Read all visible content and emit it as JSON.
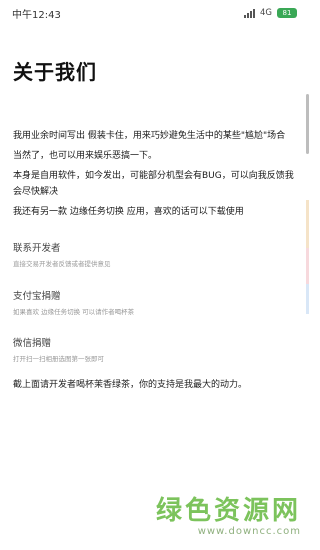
{
  "status_bar": {
    "time": "中午12:43",
    "network": "4G",
    "battery": "81"
  },
  "page": {
    "title": "关于我们"
  },
  "intro": {
    "p1": "我用业余时间写出 假装卡住，用来巧妙避免生活中的某些\"尴尬\"场合",
    "p2": "当然了，也可以用来娱乐恶搞一下。",
    "p3": "本身是自用软件，如今发出，可能部分机型会有BUG，可以向我反馈我会尽快解决",
    "p4": "我还有另一款 边缘任务切换 应用，喜欢的话可以下载使用"
  },
  "sections": [
    {
      "title": "联系开发者",
      "desc": "直接交易开发者反馈或者提供意见"
    },
    {
      "title": "支付宝捐赠",
      "desc": "如果喜欢 边缘任务切换 可以请作者喝杯茶"
    },
    {
      "title": "微信捐赠",
      "desc": "打开扫一扫相册选图第一张即可"
    }
  ],
  "footer": {
    "text": "截上面请开发者喝杯茉香绿茶，你的支持是我最大的动力。"
  },
  "watermark": {
    "main": "绿色资源网",
    "sub": "www.downcc.com"
  }
}
